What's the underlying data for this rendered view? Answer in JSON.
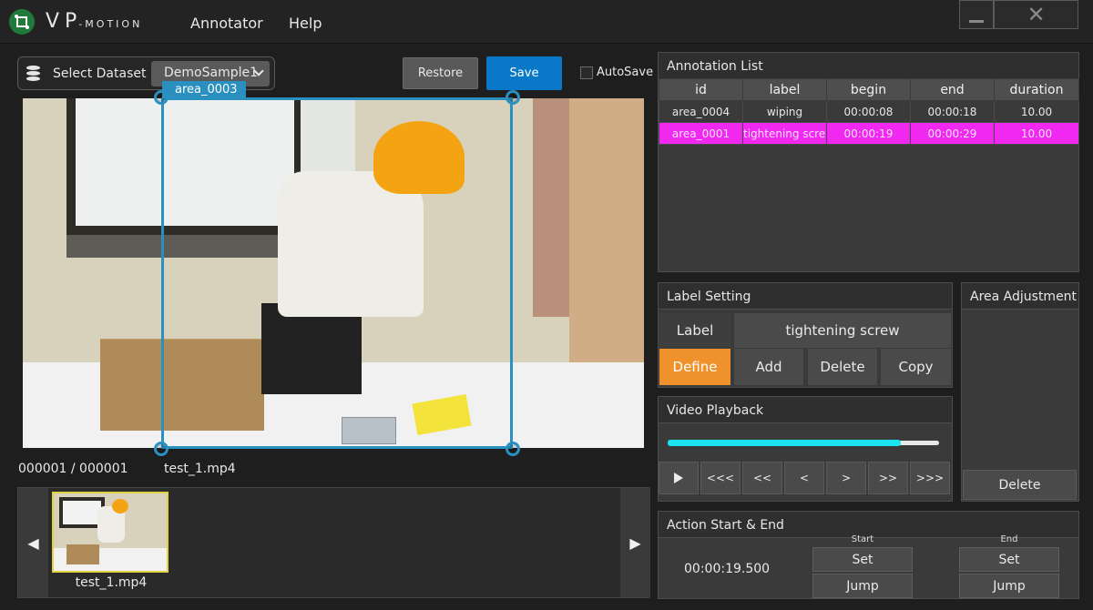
{
  "app": {
    "logo_main": "VP",
    "logo_sub": "-MOTION",
    "menu": [
      "Annotator",
      "Help"
    ]
  },
  "toolbar": {
    "dataset_label": "Select Dataset",
    "dataset_value": "DemoSample1",
    "restore_label": "Restore",
    "save_label": "Save",
    "autosave_label": "AutoSave",
    "autosave_checked": false
  },
  "video": {
    "area_tag": "area_0003",
    "frame_counter": "000001 / 000001",
    "file_name": "test_1.mp4"
  },
  "thumbnails": [
    {
      "label": "test_1.mp4"
    }
  ],
  "annotation_list": {
    "title": "Annotation List",
    "columns": [
      "id",
      "label",
      "begin",
      "end",
      "duration"
    ],
    "rows": [
      {
        "id": "area_0004",
        "label": "wiping",
        "begin": "00:00:08",
        "end": "00:00:18",
        "duration": "10.00",
        "selected": false
      },
      {
        "id": "area_0001",
        "label": "tightening screw",
        "begin": "00:00:19",
        "end": "00:00:29",
        "duration": "10.00",
        "selected": true
      }
    ]
  },
  "label_setting": {
    "title": "Label Setting",
    "label_caption": "Label",
    "label_value": "tightening screw",
    "define_label": "Define",
    "add_label": "Add",
    "delete_label": "Delete",
    "copy_label": "Copy"
  },
  "area_adjustment": {
    "title": "Area Adjustment",
    "delete_label": "Delete"
  },
  "video_playback": {
    "title": "Video Playback",
    "progress": 0.86,
    "controls": [
      "<<<",
      "<<",
      "<",
      ">",
      ">>",
      ">>>"
    ]
  },
  "action_start_end": {
    "title": "Action Start & End",
    "start_caption": "Start",
    "end_caption": "End",
    "time": "00:00:19.500",
    "set_label": "Set",
    "jump_label": "Jump"
  },
  "colors": {
    "accent_blue": "#0a78c8",
    "bbox": "#2a90c0",
    "selected_row": "#f028f0",
    "define": "#f0922c",
    "progress": "#1ae4f0"
  }
}
